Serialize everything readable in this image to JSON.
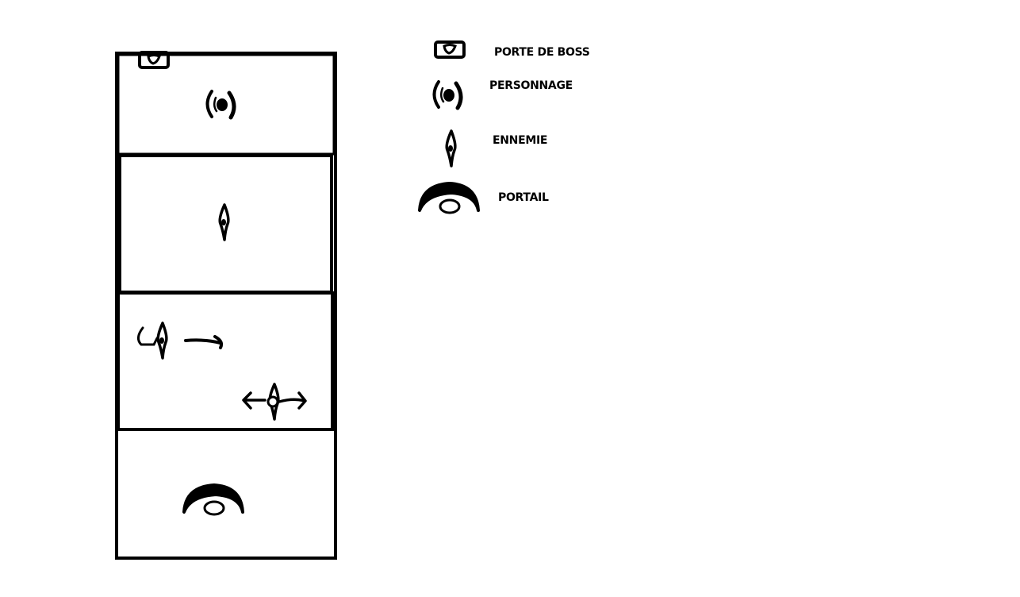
{
  "legend": {
    "items": [
      {
        "icon": "boss-door-icon",
        "label": "PORTE DE BOSS"
      },
      {
        "icon": "character-icon",
        "label": "PERSONNAGE"
      },
      {
        "icon": "enemy-icon",
        "label": "ENNEMIE"
      },
      {
        "icon": "portal-icon",
        "label": "PORTAIL"
      }
    ]
  },
  "map": {
    "rooms": [
      {
        "name": "room-1",
        "contents": [
          "boss-door-icon",
          "character-icon"
        ]
      },
      {
        "name": "room-2",
        "contents": [
          "enemy-icon"
        ]
      },
      {
        "name": "room-3",
        "contents": [
          "enemy-icon",
          "arrow-right-icon",
          "enemy-icon",
          "arrow-left-icon",
          "arrow-right-icon"
        ]
      },
      {
        "name": "room-4",
        "contents": [
          "portal-icon"
        ]
      }
    ]
  },
  "colors": {
    "ink": "#000000",
    "paper": "#ffffff"
  }
}
